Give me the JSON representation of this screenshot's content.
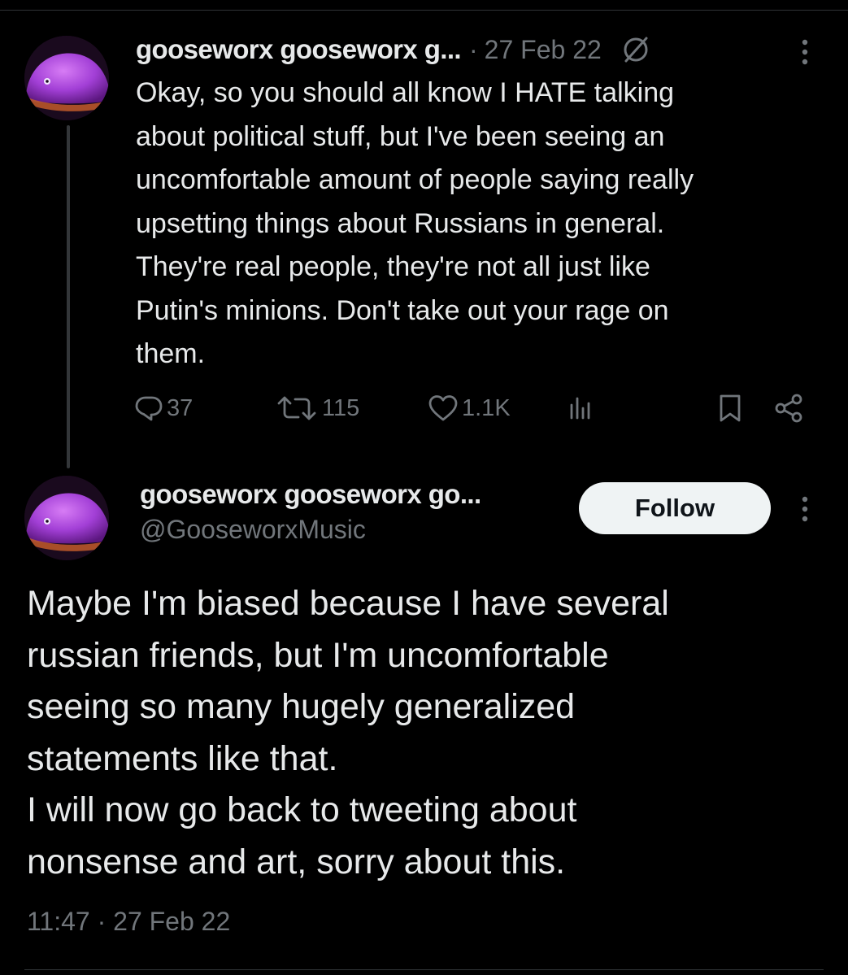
{
  "thread": {
    "tweet1": {
      "display_name": "gooseworx gooseworx g...",
      "separator": "·",
      "date": "27 Feb 22",
      "avatar_icon": "goose-avatar-icon",
      "visibility_icon": "globe-icon",
      "more_icon": "more-vertical-icon",
      "body": "Okay, so you should all know I HATE talking\nabout political stuff, but I've been seeing an\nuncomfortable amount of people saying really\nupsetting things about Russians in general.\nThey're real people, they're not all just like\nPutin's minions. Don't take out your rage on\nthem.",
      "actions": {
        "replies": "37",
        "retweets": "115",
        "likes": "1.1K",
        "reply_icon": "reply-icon",
        "retweet_icon": "retweet-icon",
        "like_icon": "heart-icon",
        "views_icon": "views-icon",
        "bookmark_icon": "bookmark-icon",
        "share_icon": "share-icon"
      }
    },
    "tweet2": {
      "display_name": "gooseworx gooseworx go...",
      "handle": "@GooseworxMusic",
      "follow_label": "Follow",
      "avatar_icon": "goose-avatar-icon",
      "more_icon": "more-vertical-icon",
      "body": "Maybe I'm biased because I have several\nrussian friends, but I'm uncomfortable\nseeing so many hugely generalized\nstatements like that.\nI will now go back to tweeting about\nnonsense and art, sorry about this.",
      "timestamp": "11:47 · 27 Feb 22"
    }
  },
  "colors": {
    "background": "#000000",
    "text_primary": "#e7e9ea",
    "text_secondary": "#71767b",
    "follow_button_bg": "#eff3f4",
    "follow_button_text": "#0f1419",
    "avatar_purple": "#a23fd6"
  }
}
